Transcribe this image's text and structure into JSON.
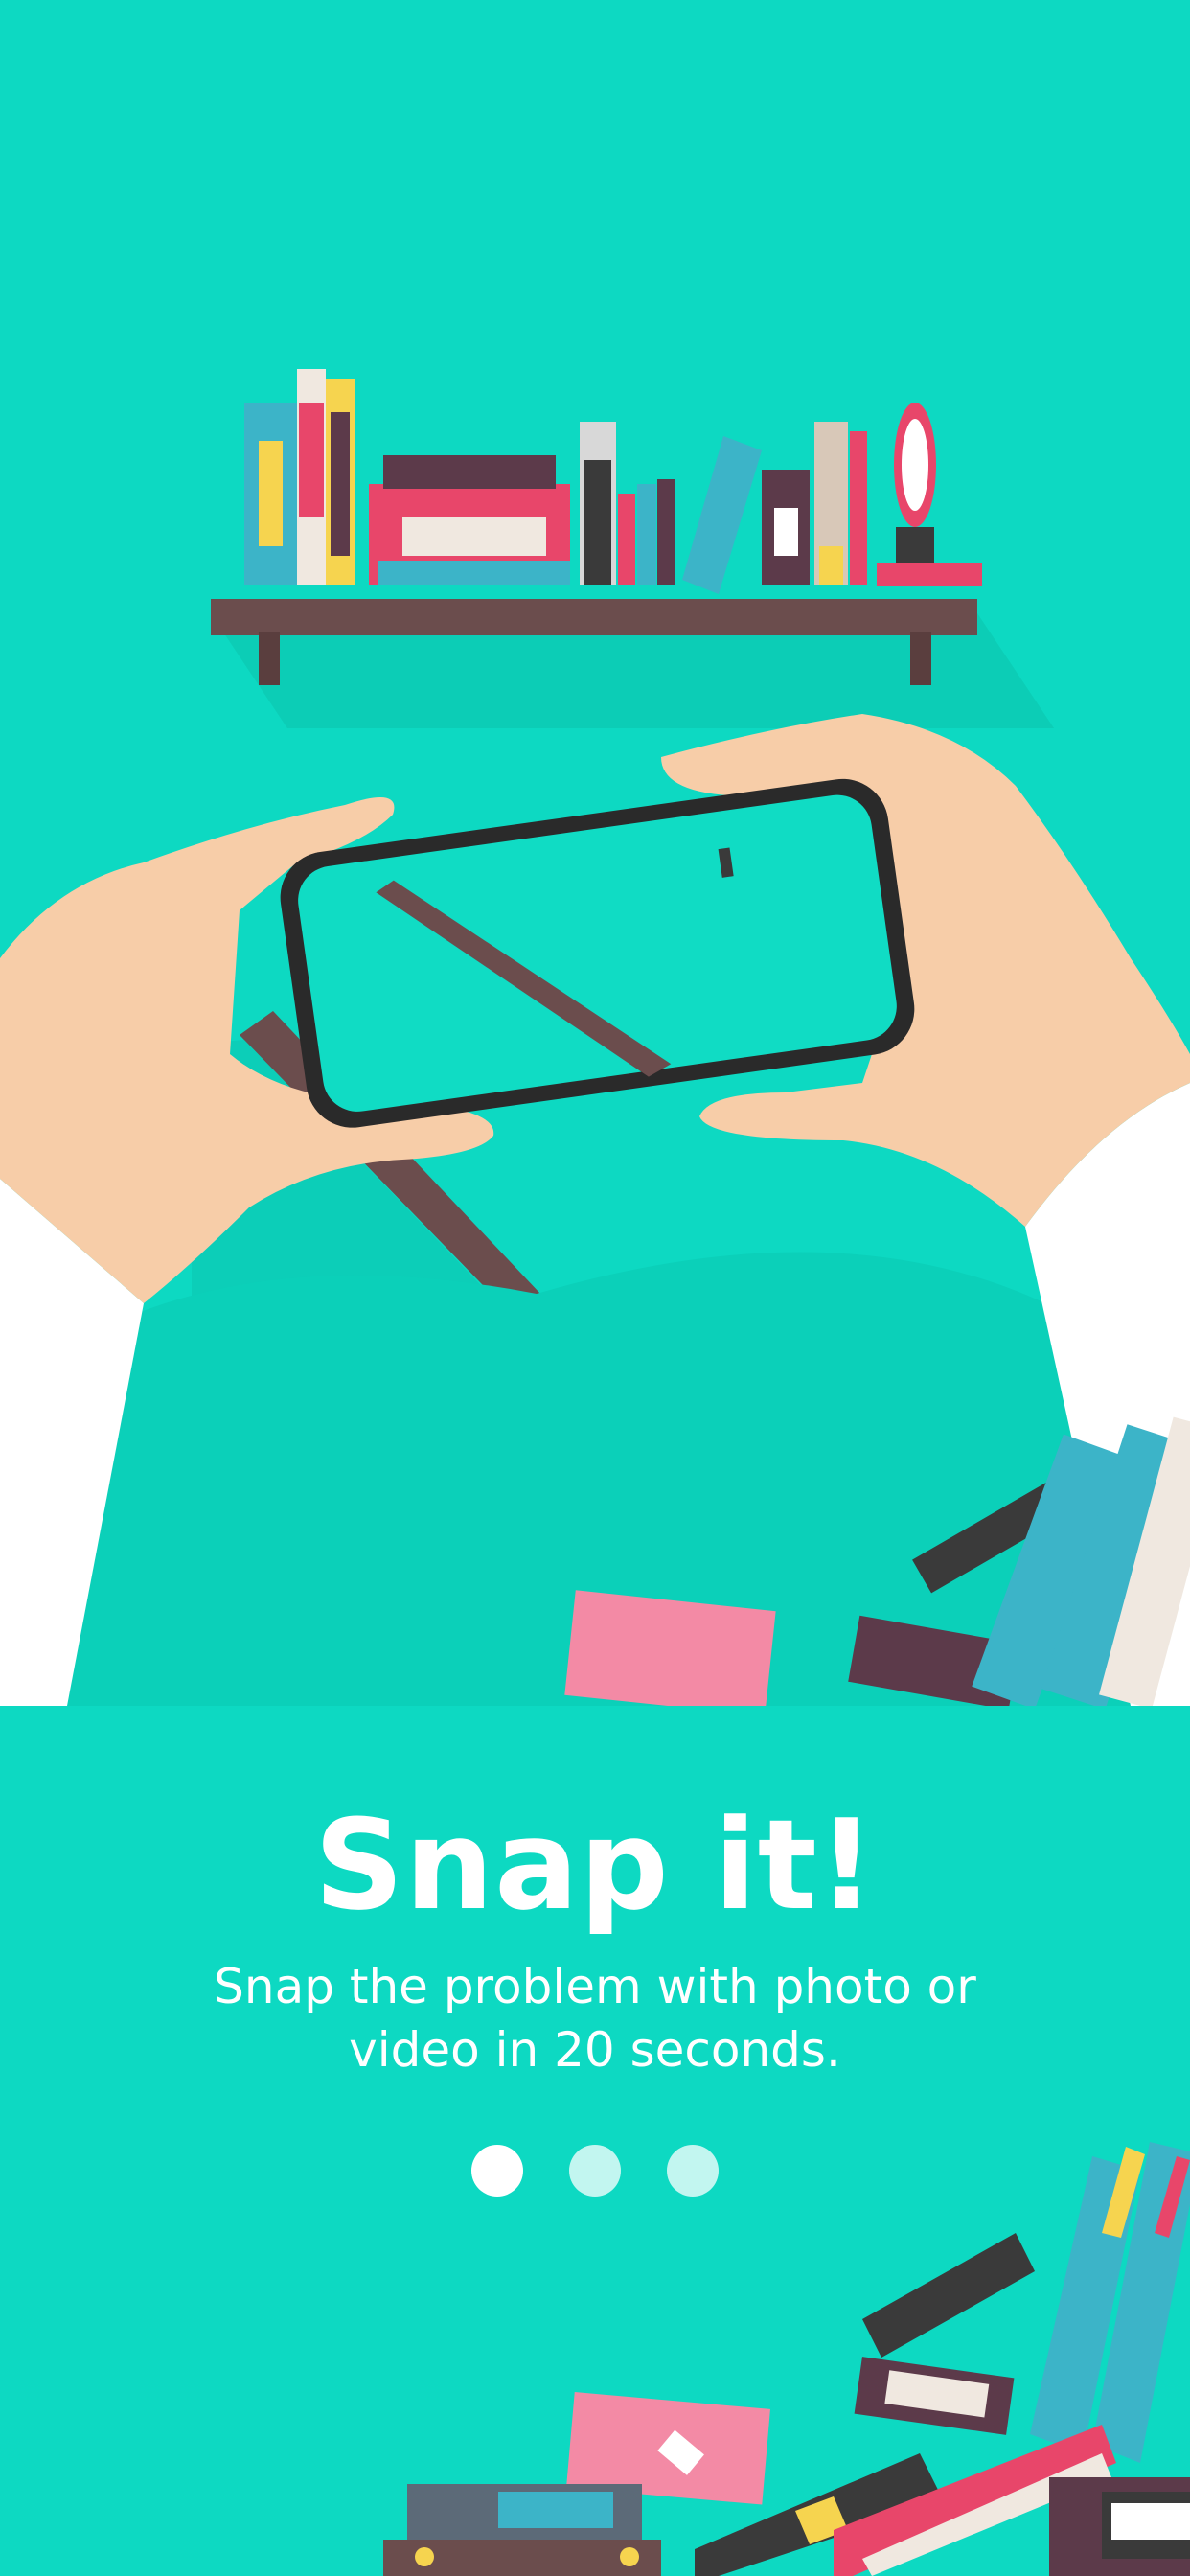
{
  "onboarding": {
    "title": "Snap it!",
    "subtitle_line1": "Snap the problem with photo or",
    "subtitle_line2": "video in 20 seconds.",
    "page_count": 3,
    "current_page": 1
  },
  "colors": {
    "background": "#0dd9c2",
    "shelf": "#6b4d4d",
    "skin": "#f7cda8",
    "sleeve": "#ffffff",
    "phone_frame": "#2a2a2a"
  }
}
